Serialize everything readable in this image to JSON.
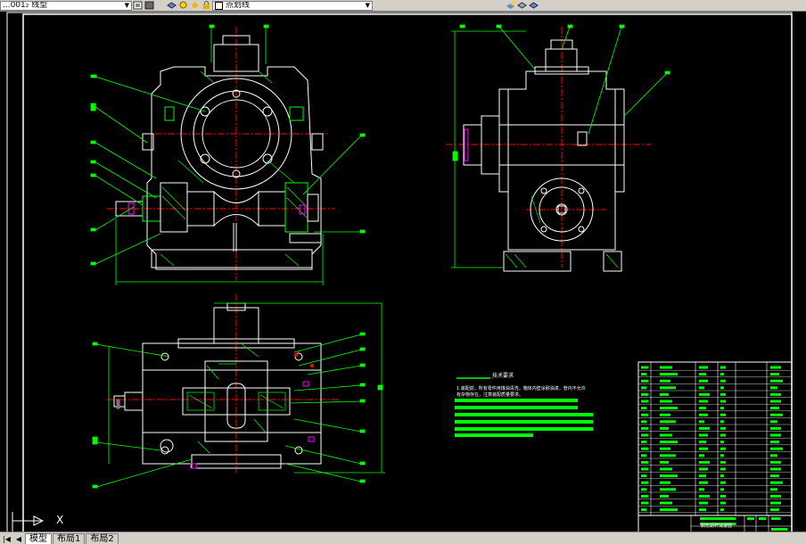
{
  "toolbar": {
    "layer_combo_value": "...001₂ 线型",
    "linetype_combo_value": "点划线"
  },
  "ucs": {
    "x_label": "X"
  },
  "tabs": {
    "items": [
      "模型",
      "布局1",
      "布局2"
    ]
  },
  "notes": {
    "title": "技术要求",
    "line1": "1.装配前，所有零件用煤油清洗，箱体内壁涂耐油漆，管内不允许",
    "line2": "有杂物存在，注意装配质量要求。"
  },
  "title_block": {
    "name": "蜗轮蜗杆减速器"
  },
  "colors": {
    "background": "#000000",
    "outline": "#ffffff",
    "dimension": "#00ff00",
    "centerline": "#ff0000",
    "hatch": "#00ff00",
    "magenta": "#ff00ff",
    "toolbar": "#d4d0c8"
  }
}
